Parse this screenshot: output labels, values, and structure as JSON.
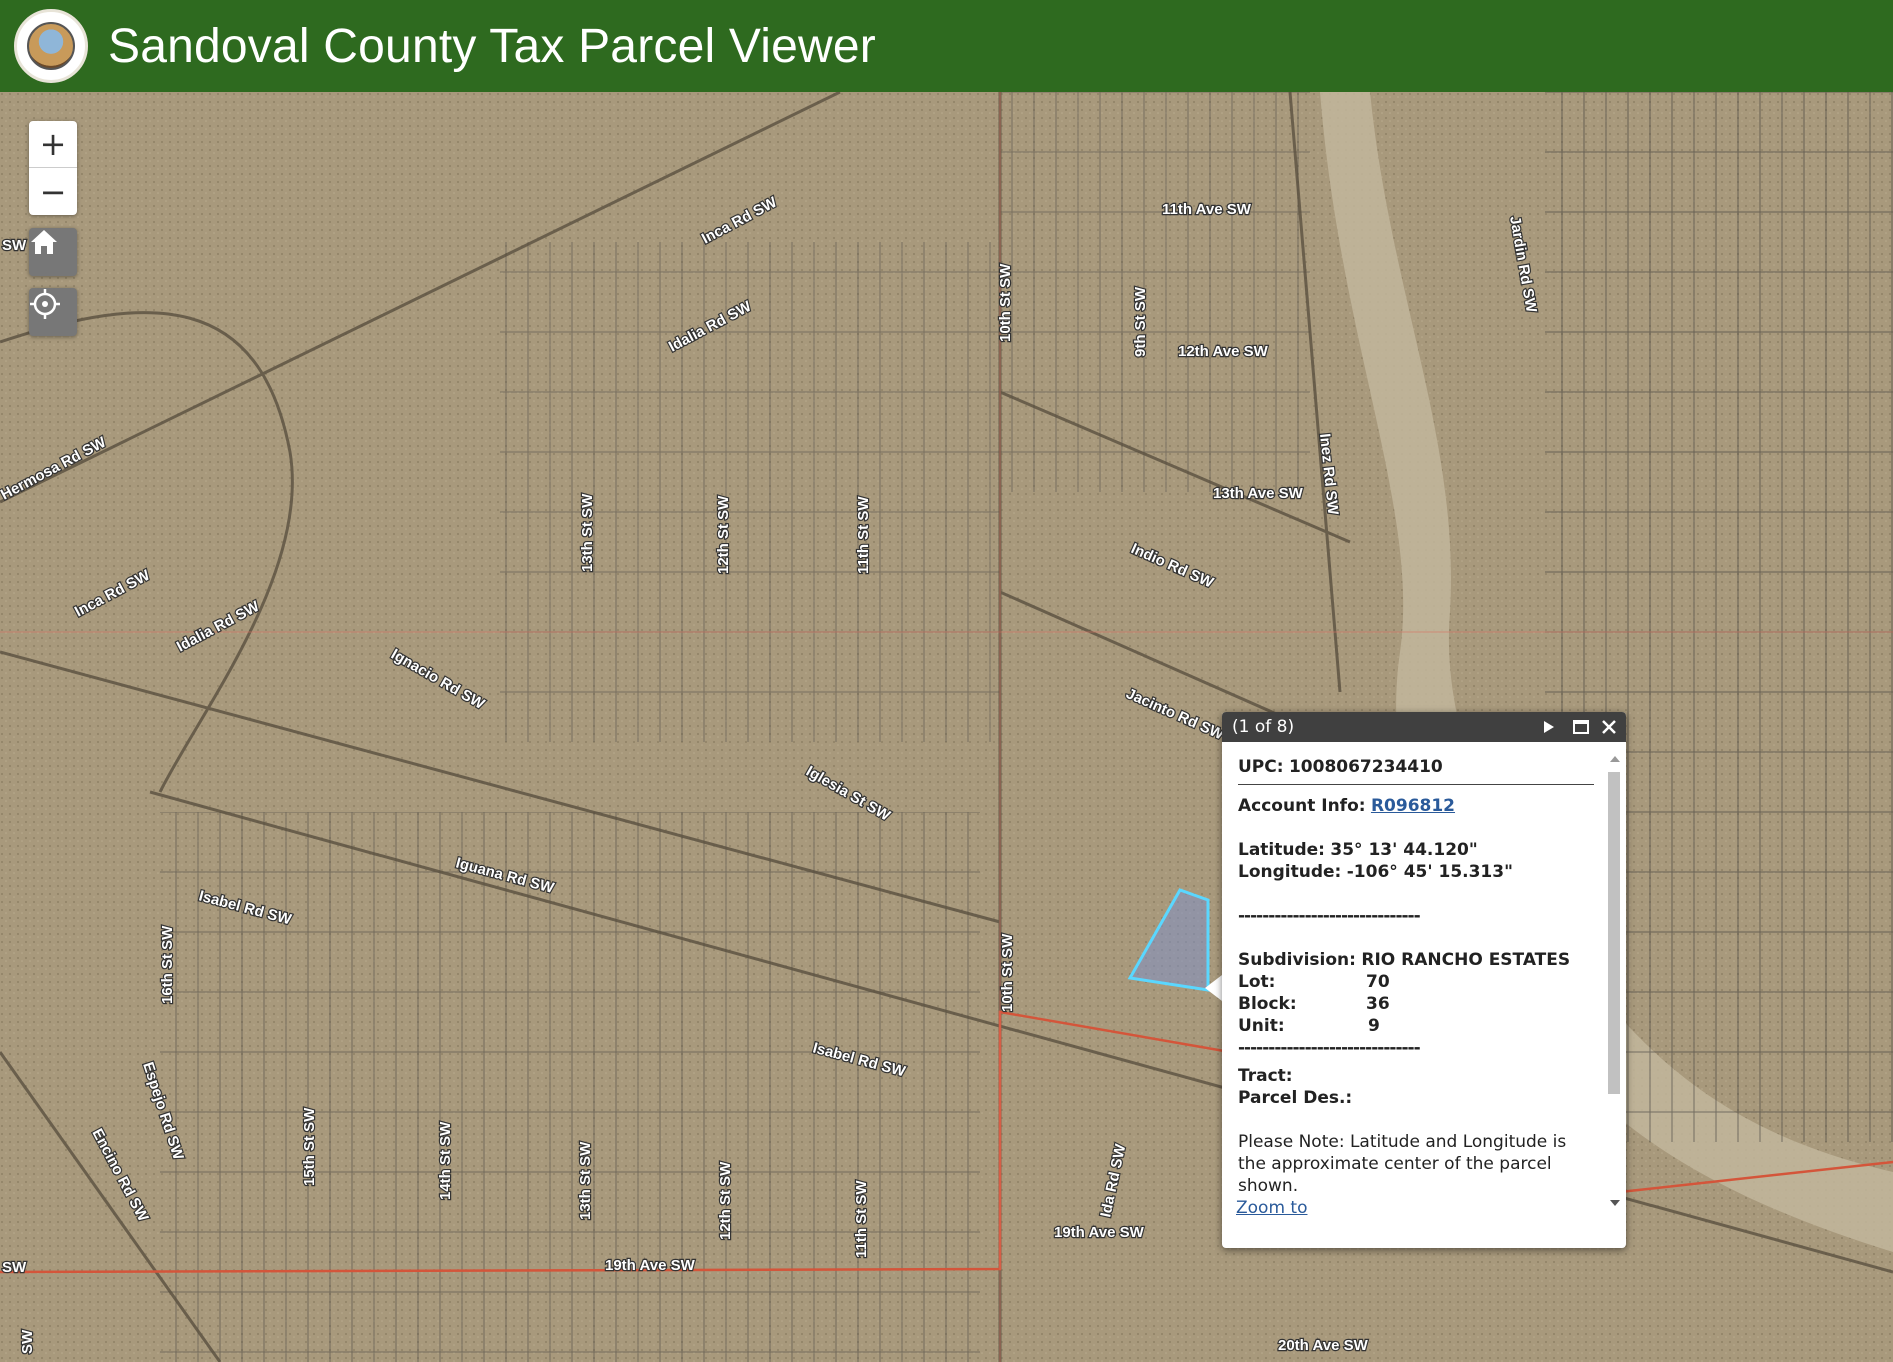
{
  "header": {
    "title": "Sandoval County Tax Parcel Viewer",
    "logo_icon": "county-seal-icon"
  },
  "map": {
    "base": "aerial-imagery",
    "streets": [
      "Inca Rd SW",
      "Idalia Rd SW",
      "Inca Rd SW",
      "Idalia Rd SW",
      "Hermosa Rd SW",
      "11th Ave SW",
      "12th Ave SW",
      "13th Ave SW",
      "Indio Rd SW",
      "Jacinto Rd SW",
      "10th St SW",
      "9th St SW",
      "Jardin Rd SW",
      "Inez Rd SW",
      "13th St SW",
      "12th St SW",
      "11th St SW",
      "Ignacio Rd SW",
      "Iglesia St SW",
      "Iguana Rd SW",
      "Isabel Rd SW",
      "Isabel Rd SW",
      "16th St SW",
      "Espejo Rd SW",
      "Encino Rd SW",
      "15th St SW",
      "14th St SW",
      "13th St SW",
      "12th St SW",
      "11th St SW",
      "10th St SW",
      "Ida Rd SW",
      "19th Ave SW",
      "19th Ave SW",
      "20th Ave SW",
      "SW",
      "SW",
      "SW"
    ]
  },
  "controls": {
    "zoom_in": "+",
    "zoom_out": "−",
    "home_icon": "home-icon",
    "locate_icon": "locate-icon"
  },
  "popup": {
    "counter": "(1 of 8)",
    "upc_label": "UPC:",
    "upc_value": "1008067234410",
    "account_label": "Account Info:",
    "account_value": "R096812",
    "lat_label": "Latitude:",
    "lat_value": "35° 13' 44.120\"",
    "lon_label": "Longitude:",
    "lon_value": "-106° 45' 15.313\"",
    "divider1": "------------------------------",
    "subdivision_label": "Subdivision:",
    "subdivision_value": "RIO RANCHO ESTATES",
    "lot_label": "Lot:",
    "lot_value": "70",
    "block_label": "Block:",
    "block_value": "36",
    "unit_label": "Unit:",
    "unit_value": "9",
    "divider2": "------------------------------",
    "tract_label": "Tract:",
    "parcel_des_label": "Parcel Des.:",
    "note": "Please Note: Latitude and Longitude is the approximate center of the parcel shown.",
    "zoom_link": "Zoom to"
  }
}
